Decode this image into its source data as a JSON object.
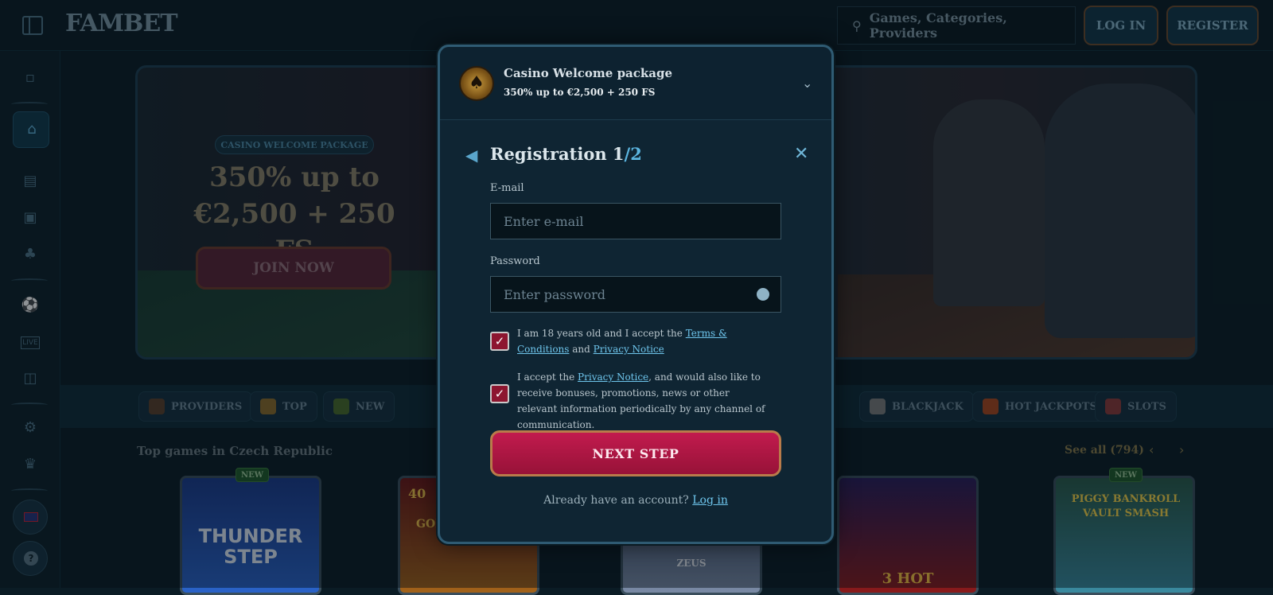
{
  "header": {
    "logo": "FAMBET",
    "search_placeholder": "Games, Categories, Providers",
    "login_label": "LOG IN",
    "register_label": "REGISTER"
  },
  "sidebar": {
    "items": [
      {
        "icon": "gift-icon"
      },
      {
        "icon": "home-icon"
      },
      {
        "icon": "slot-machine-icon"
      },
      {
        "icon": "cards-icon"
      },
      {
        "icon": "clover-icon"
      },
      {
        "icon": "ball-icon"
      },
      {
        "icon": "live-icon",
        "label": "LIVE"
      },
      {
        "icon": "monitor-icon"
      },
      {
        "icon": "settings-icon"
      },
      {
        "icon": "trophy-icon"
      },
      {
        "icon": "flag-uk-icon"
      },
      {
        "icon": "help-icon",
        "label": "?"
      }
    ]
  },
  "hero": {
    "badge": "CASINO WELCOME PACKAGE",
    "title_line1": "350% up to",
    "title_line2": "€2,500 + 250 FS",
    "cta": "JOIN NOW"
  },
  "categories": [
    "PROVIDERS",
    "TOP",
    "NEW",
    "BLACKJACK",
    "HOT JACKPOTS",
    "SLOTS"
  ],
  "top_games": {
    "title": "Top games in Czech Republic",
    "see_all": "See all (794)",
    "new_badge": "NEW",
    "games": [
      "THUNDER STEP",
      "40",
      "GOLD",
      "ZEUS",
      "3 HOT",
      "PIGGY BANKROLL VAULT SMASH"
    ]
  },
  "modal": {
    "package_title": "Casino Welcome package",
    "package_sub": "350% up to €2,500 + 250 FS",
    "reg_title": "Registration 1",
    "reg_step": "/2",
    "email_label": "E-mail",
    "email_placeholder": "Enter e-mail",
    "password_label": "Password",
    "password_placeholder": "Enter password",
    "consent1_pre": "I am 18 years old and I accept the ",
    "consent1_link1": "Terms & Conditions",
    "consent1_mid": " and ",
    "consent1_link2": "Privacy Notice",
    "consent2_pre": "I accept the ",
    "consent2_link": "Privacy Notice",
    "consent2_post": ", and would also like to receive bonuses, promotions, news or other relevant information periodically by any channel of communication.",
    "next_label": "NEXT STEP",
    "have_account": "Already have an account? ",
    "login_link": "Log in"
  },
  "colors": {
    "accent": "#c21b4e",
    "link": "#6ec5ec",
    "background": "#0b1c25"
  }
}
